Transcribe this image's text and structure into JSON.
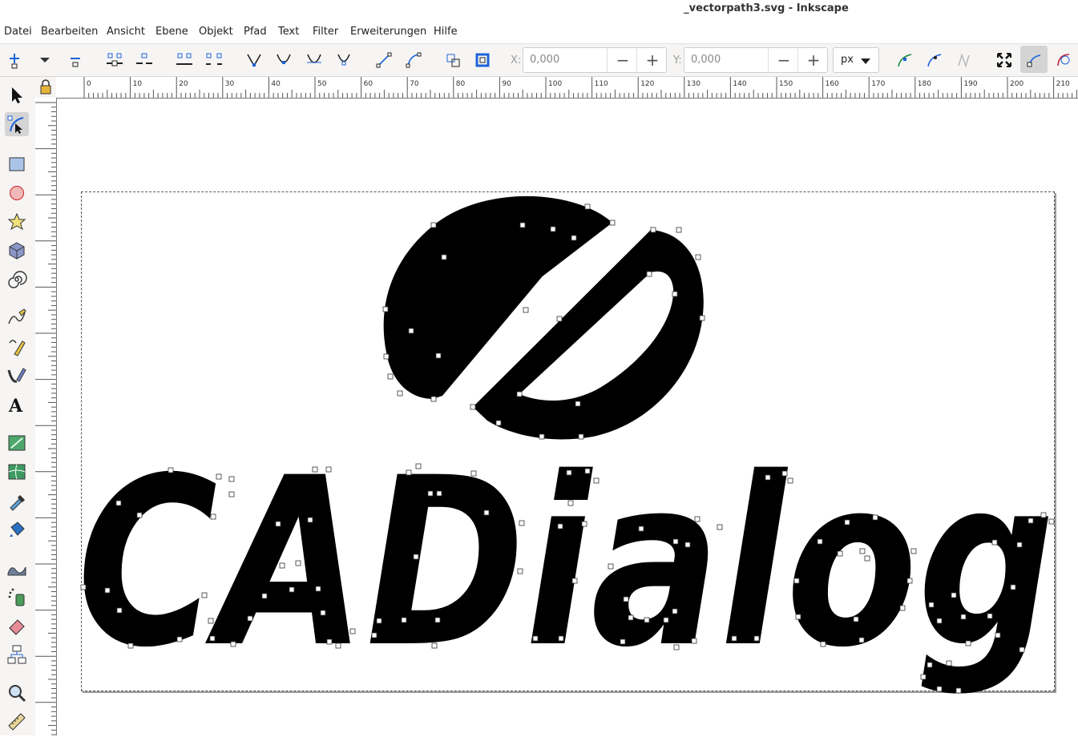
{
  "window": {
    "title": "_vectorpath3.svg - Inkscape"
  },
  "menu": [
    "Datei",
    "Bearbeiten",
    "Ansicht",
    "Ebene",
    "Objekt",
    "Pfad",
    "Text",
    "Filter",
    "Erweiterungen",
    "Hilfe"
  ],
  "toolbar": {
    "x_label": "X:",
    "x_value": "0,000",
    "y_label": "Y:",
    "y_value": "0,000",
    "minus": "−",
    "plus": "+",
    "unit": "px"
  },
  "ruler": {
    "h_labels": [
      "0",
      "10",
      "20",
      "30",
      "40",
      "50",
      "60",
      "70",
      "80",
      "90",
      "100",
      "110",
      "120",
      "130",
      "140",
      "150",
      "160",
      "170",
      "180",
      "190",
      "200",
      "210"
    ]
  },
  "tools": [
    "selector-tool-icon",
    "node-tool-icon",
    "rectangle-tool-icon",
    "ellipse-tool-icon",
    "star-tool-icon",
    "3d-box-tool-icon",
    "spiral-tool-icon",
    "pencil-tool-icon",
    "pen-tool-icon",
    "calligraphy-tool-icon",
    "text-tool-icon",
    "gradient-tool-icon",
    "mesh-tool-icon",
    "dropper-tool-icon",
    "paint-bucket-tool-icon",
    "tweak-tool-icon",
    "spray-tool-icon",
    "eraser-tool-icon",
    "connector-tool-icon",
    "zoom-tool-icon",
    "measure-tool-icon"
  ],
  "canvas": {
    "logo_text": "CADialog"
  },
  "colors": {
    "node": "#ffffff",
    "artwork": "#000000",
    "accent": "#1d62d8"
  }
}
